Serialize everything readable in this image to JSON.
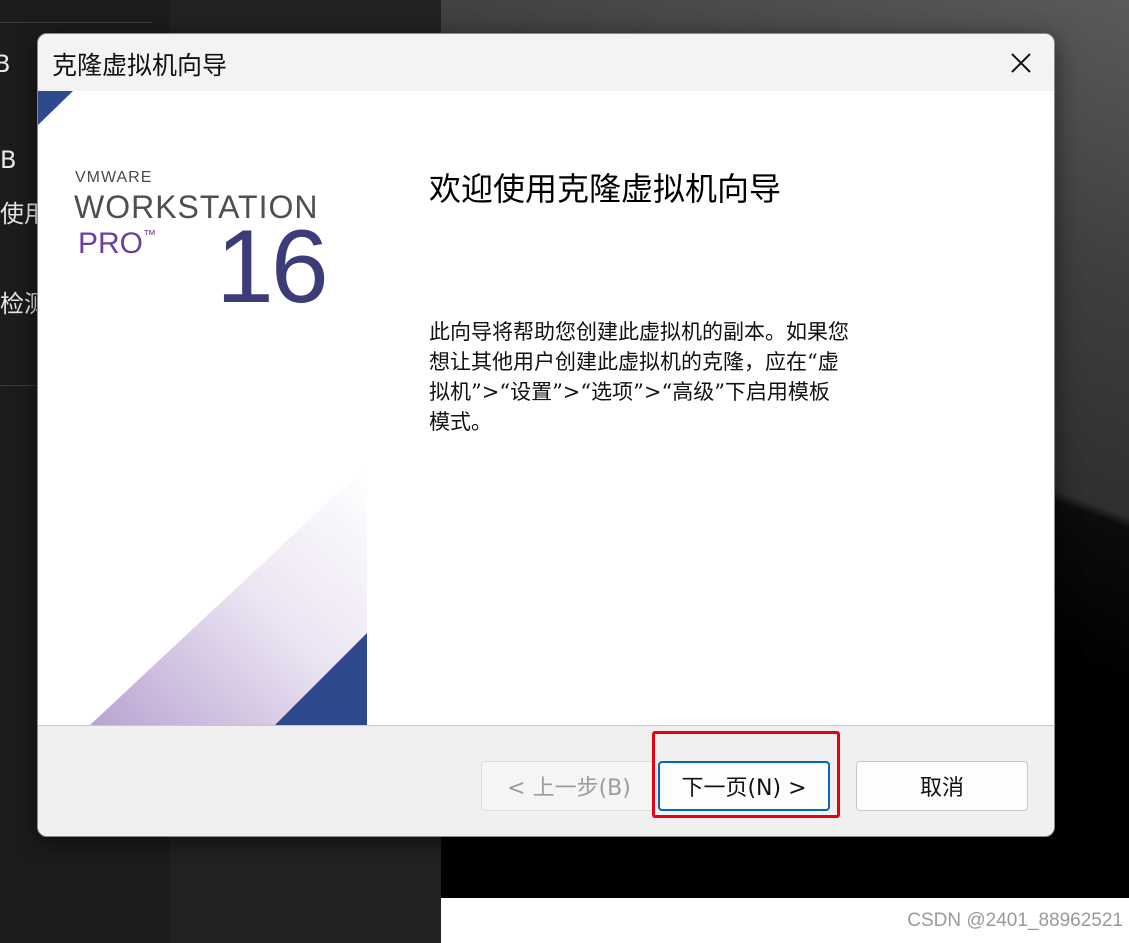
{
  "background": {
    "left_text_fragments": [
      "B",
      "B",
      "使用",
      "检测"
    ]
  },
  "dialog": {
    "title": "克隆虚拟机向导",
    "close_icon": "close-icon",
    "brand": {
      "vmware": "VMWARE",
      "workstation": "WORKSTATION",
      "pro": "PRO",
      "tm": "™",
      "version": "16"
    },
    "heading": "欢迎使用克隆虚拟机向导",
    "description": "此向导将帮助您创建此虚拟机的副本。如果您想让其他用户创建此虚拟机的克隆，应在“虚拟机”>“设置”>“选项”>“高级”下启用模板模式。",
    "buttons": {
      "back": "< 上一步(B)",
      "next": "下一页(N) >",
      "cancel": "取消"
    }
  },
  "watermark": "CSDN @2401_88962521",
  "colors": {
    "banner_blue": "#2e4a8c",
    "pro_purple": "#6b3fa0",
    "highlight_red": "#e60012"
  }
}
